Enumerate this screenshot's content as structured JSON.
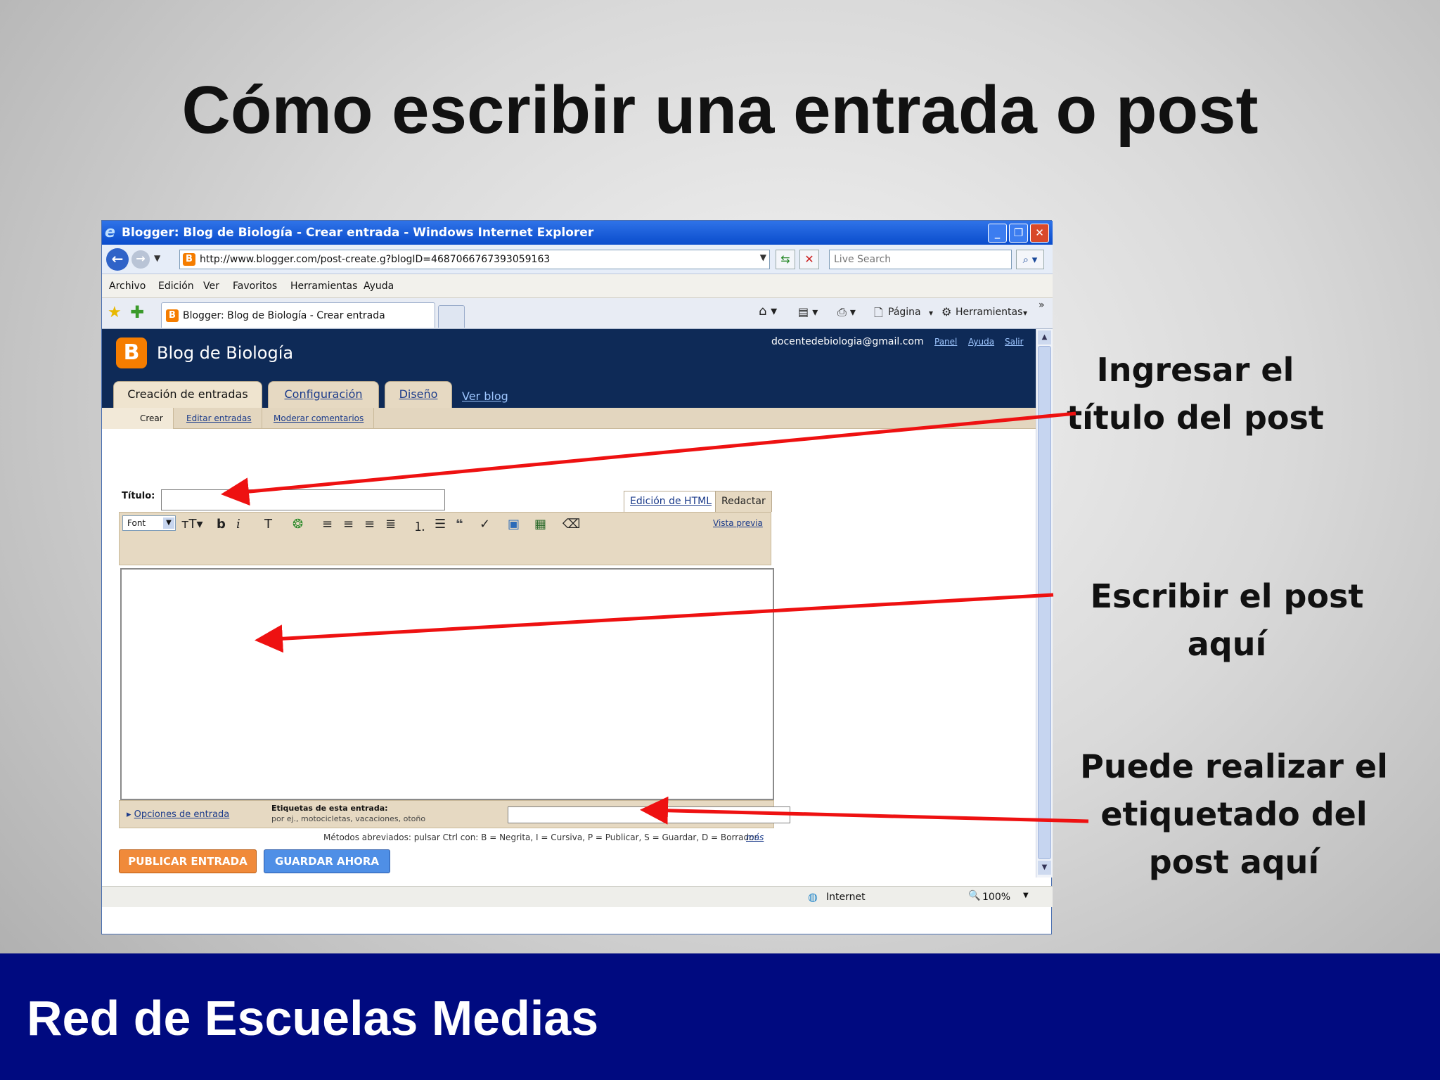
{
  "slide": {
    "title": "Cómo escribir una entrada o post",
    "footer": "Red de Escuelas Medias",
    "annotations": [
      "Ingresar el título del post",
      "Escribir el post aquí",
      "Puede realizar el etiquetado del post aquí"
    ]
  },
  "browser": {
    "window_title": "Blogger: Blog de Biología - Crear entrada - Windows Internet Explorer",
    "url": "http://www.blogger.com/post-create.g?blogID=4687066767393059163",
    "search_placeholder": "Live Search",
    "menu": [
      "Archivo",
      "Edición",
      "Ver",
      "Favoritos",
      "Herramientas",
      "Ayuda"
    ],
    "tab_title": "Blogger: Blog de Biología - Crear entrada",
    "commands": {
      "page": "Página",
      "tools": "Herramientas"
    },
    "status": {
      "zone": "Internet",
      "zoom": "100%"
    }
  },
  "blogger": {
    "blog_name": "Blog de Biología",
    "logo_letter": "B",
    "email": "docentedebiologia@gmail.com",
    "header_links": [
      "Panel",
      "Ayuda",
      "Salir"
    ],
    "tabs": [
      "Creación de entradas",
      "Configuración",
      "Diseño"
    ],
    "view_blog": "Ver blog",
    "subnav": [
      "Crear",
      "Editar entradas",
      "Moderar comentarios"
    ],
    "title_label": "Título:",
    "modes": [
      "Edición de HTML",
      "Redactar"
    ],
    "font_select": "Font",
    "preview": "Vista previa",
    "post_options": "Opciones de entrada",
    "labels_label": "Etiquetas de esta entrada:",
    "labels_hint": "por ej., motocicletas, vacaciones, otoño",
    "shortcuts": "Métodos abreviados: pulsar Ctrl con: B = Negrita, I = Cursiva, P = Publicar, S = Guardar, D = Borrador",
    "shortcuts_more": "más",
    "publish_button": "PUBLICAR ENTRADA",
    "save_button": "GUARDAR AHORA"
  },
  "colors": {
    "footer_bg": "#000a80",
    "arrow": "#ee1111",
    "blog_header": "#0e2a57",
    "publish_btn": "#f08a3a",
    "save_btn": "#4f8fe6"
  }
}
